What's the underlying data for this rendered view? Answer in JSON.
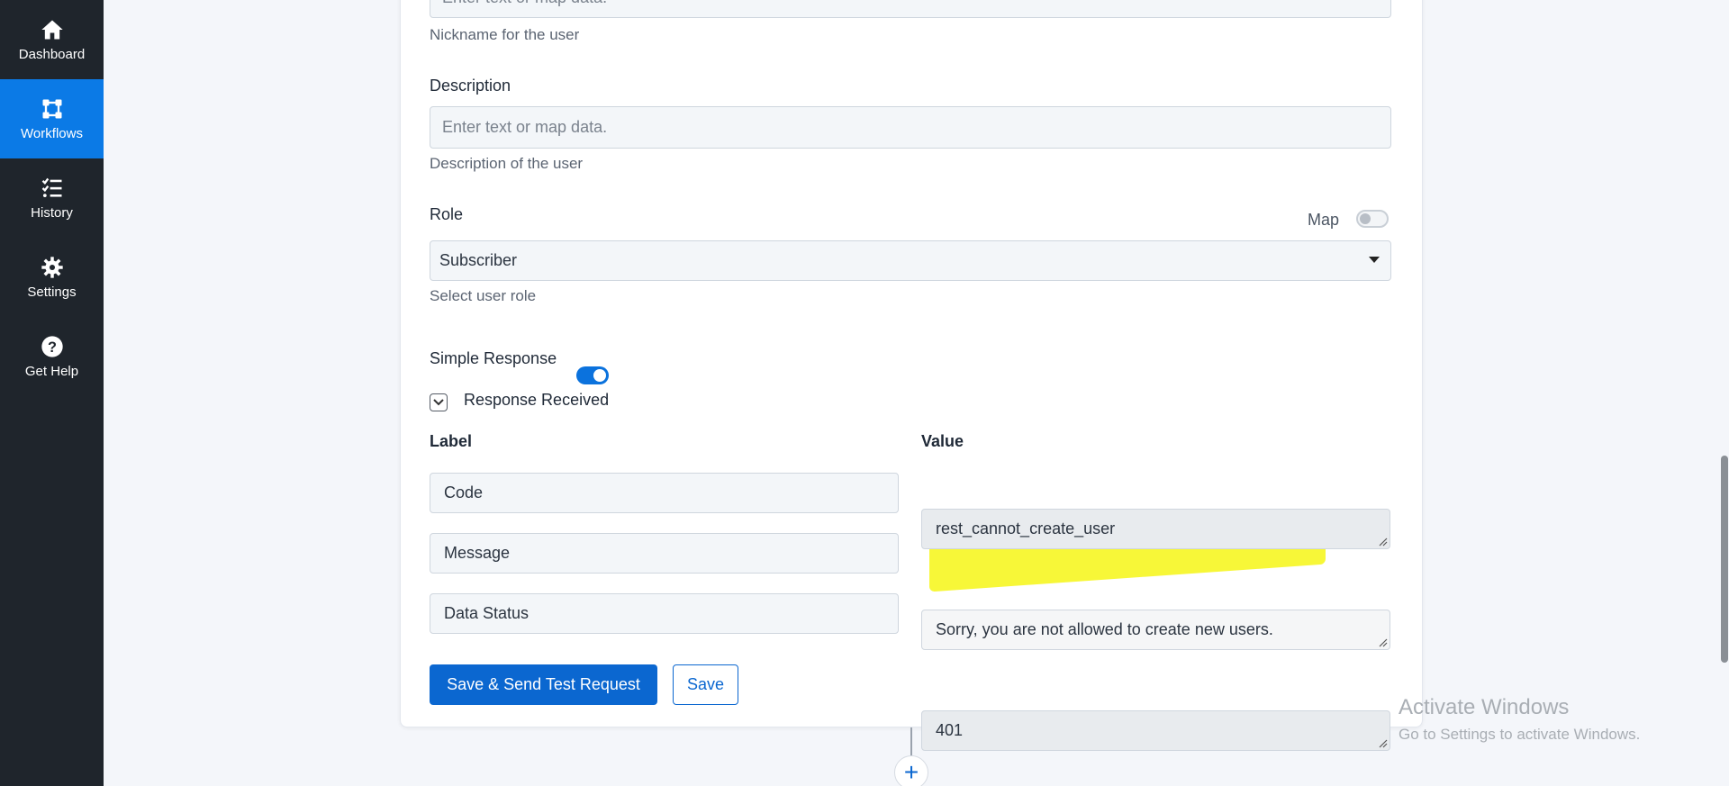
{
  "sidebar": {
    "items": [
      {
        "label": "Dashboard",
        "icon": "home-icon",
        "active": false
      },
      {
        "label": "Workflows",
        "icon": "workflows-icon",
        "active": true
      },
      {
        "label": "History",
        "icon": "history-list-icon",
        "active": false
      },
      {
        "label": "Settings",
        "icon": "gear-icon",
        "active": false
      },
      {
        "label": "Get Help",
        "icon": "question-circle-icon",
        "active": false
      }
    ]
  },
  "form": {
    "nickname": {
      "placeholder": "Enter text or map data.",
      "helper": "Nickname for the user"
    },
    "description": {
      "label": "Description",
      "placeholder": "Enter text or map data.",
      "helper": "Description of the user"
    },
    "role": {
      "label": "Role",
      "map_label": "Map",
      "selected": "Subscriber",
      "helper": "Select user role"
    },
    "simple_response": {
      "label": "Simple Response",
      "enabled": true
    },
    "response_received": {
      "label": "Response Received"
    }
  },
  "response_table": {
    "label_header": "Label",
    "value_header": "Value",
    "rows": [
      {
        "label": "Code",
        "value": "rest_cannot_create_user"
      },
      {
        "label": "Message",
        "value": "Sorry, you are not allowed to create new users."
      },
      {
        "label": "Data Status",
        "value": "401"
      }
    ]
  },
  "actions": {
    "save_send": "Save & Send Test Request",
    "save": "Save"
  },
  "watermark": {
    "line1": "Activate Windows",
    "line2": "Go to Settings to activate Windows."
  },
  "colors": {
    "sidebar_bg": "#1f252c",
    "active_nav": "#0b7ae6",
    "primary": "#0b67d0",
    "highlight": "#f6f61c"
  }
}
